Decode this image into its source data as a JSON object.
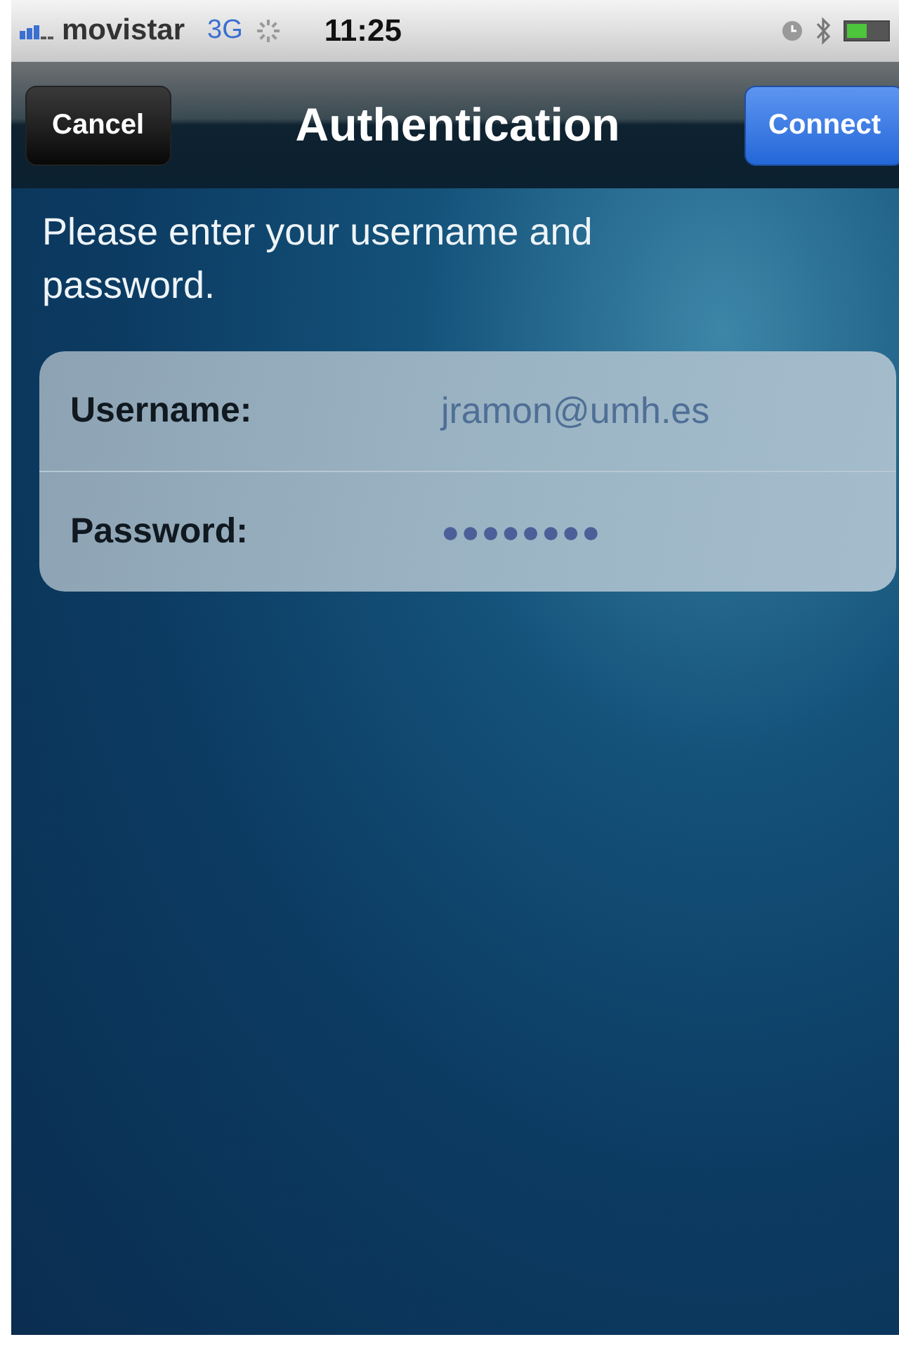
{
  "status_bar": {
    "carrier": "movistar",
    "network": "3G",
    "time": "11:25"
  },
  "nav_bar": {
    "left_button": "Cancel",
    "title": "Authentication",
    "right_button": "Connect"
  },
  "prompt": "Please enter your username and password.",
  "fields": [
    {
      "label": "Username:",
      "value": "jramon@umh.es"
    },
    {
      "label": "Password:",
      "value": "●●●●●●●●"
    }
  ]
}
